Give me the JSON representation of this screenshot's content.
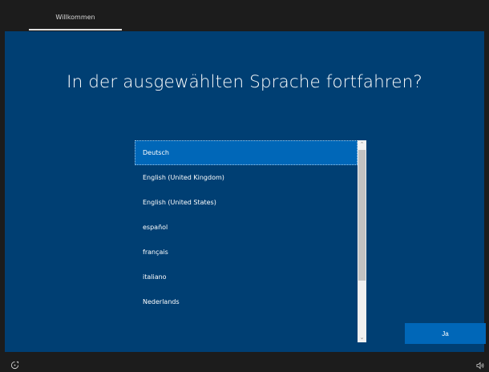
{
  "topbar": {
    "tab_label": "Willkommen"
  },
  "main": {
    "headline": "In der ausgewählten Sprache fortfahren?",
    "languages": [
      {
        "label": "Deutsch",
        "selected": true
      },
      {
        "label": "English (United Kingdom)",
        "selected": false
      },
      {
        "label": "English (United States)",
        "selected": false
      },
      {
        "label": "español",
        "selected": false
      },
      {
        "label": "français",
        "selected": false
      },
      {
        "label": "italiano",
        "selected": false
      },
      {
        "label": "Nederlands",
        "selected": false
      }
    ],
    "confirm_label": "Ja"
  },
  "scrollbar": {
    "up_glyph": "⌃",
    "down_glyph": "⌄"
  },
  "bottombar": {
    "left_icon": "ease-of-access-icon",
    "right_icon": "volume-icon"
  },
  "colors": {
    "panel_bg": "#003f73",
    "accent": "#0067b8",
    "chrome_bg": "#1c1c1c"
  }
}
